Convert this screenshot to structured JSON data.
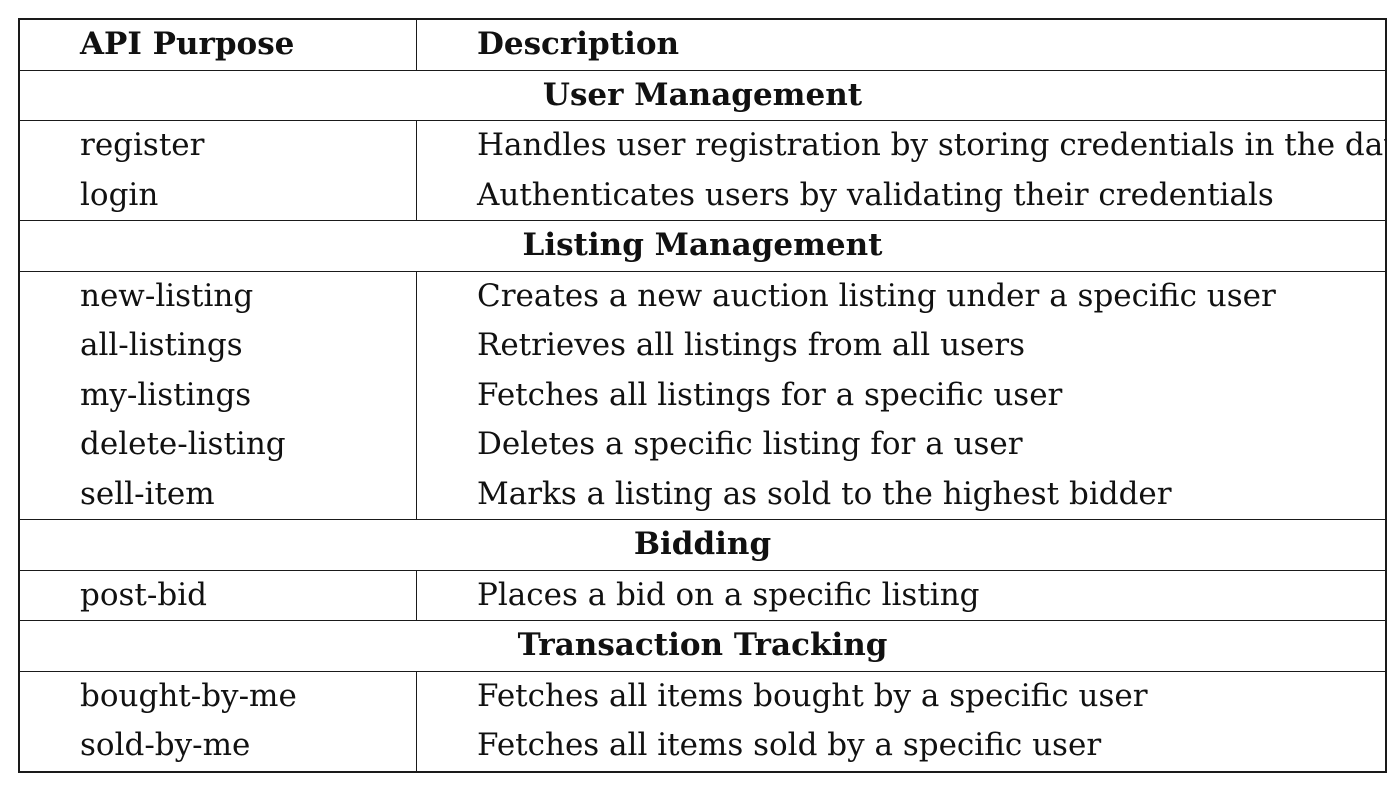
{
  "table": {
    "headers": {
      "purpose": "API Purpose",
      "description": "Description"
    },
    "sections": [
      {
        "title": "User Management",
        "rows": [
          {
            "api": "register",
            "description": "Handles user registration by storing credentials in the database"
          },
          {
            "api": "login",
            "description": "Authenticates users by validating their credentials"
          }
        ]
      },
      {
        "title": "Listing Management",
        "rows": [
          {
            "api": "new-listing",
            "description": "Creates a new auction listing under a specific user"
          },
          {
            "api": "all-listings",
            "description": "Retrieves all listings from all users"
          },
          {
            "api": "my-listings",
            "description": "Fetches all listings for a specific user"
          },
          {
            "api": "delete-listing",
            "description": "Deletes a specific listing for a user"
          },
          {
            "api": "sell-item",
            "description": "Marks a listing as sold to the highest bidder"
          }
        ]
      },
      {
        "title": "Bidding",
        "rows": [
          {
            "api": "post-bid",
            "description": "Places a bid on a specific listing"
          }
        ]
      },
      {
        "title": "Transaction Tracking",
        "rows": [
          {
            "api": "bought-by-me",
            "description": "Fetches all items bought by a specific user"
          },
          {
            "api": "sold-by-me",
            "description": "Fetches all items sold by a specific user"
          }
        ]
      }
    ]
  }
}
